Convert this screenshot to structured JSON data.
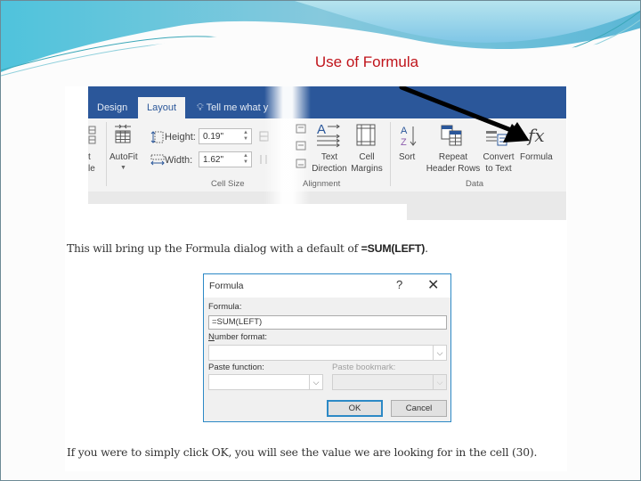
{
  "slide": {
    "title": "Use of Formula",
    "colors": {
      "title": "#c0141b",
      "ribbon_blue": "#2b579a",
      "dialog_border": "#2c89c6"
    }
  },
  "ribbon": {
    "tabs": [
      {
        "label": "Design",
        "active": false
      },
      {
        "label": "Layout",
        "active": true
      },
      {
        "label": "Tell me what y",
        "active": false,
        "icon": "lightbulb-icon"
      }
    ],
    "partial_left": {
      "line1": "t",
      "line2": "le"
    },
    "autofit": {
      "label": "AutoFit",
      "icon": "autofit-table-icon"
    },
    "cell_size": {
      "height_label": "Height:",
      "height_value": "0.19\"",
      "width_label": "Width:",
      "width_value": "1.62\"",
      "group_label": "Cell Size"
    },
    "alignment": {
      "text_direction": {
        "line1": "Text",
        "line2": "Direction"
      },
      "cell_margins": {
        "line1": "Cell",
        "line2": "Margins"
      },
      "group_label": "Alignment"
    },
    "data": {
      "sort": "Sort",
      "repeat_header_rows": {
        "line1": "Repeat",
        "line2": "Header Rows"
      },
      "convert_to_text": {
        "line1": "Convert",
        "line2": "to Text"
      },
      "formula": {
        "label": "Formula",
        "glyph": "fx"
      },
      "group_label": "Data"
    }
  },
  "text": {
    "intro_prefix": "This will bring up the Formula dialog with a default of ",
    "intro_bold": "=SUM(LEFT)",
    "intro_suffix": ".",
    "outro": "If you were to simply click OK, you will see the value we are looking for in the cell (30)."
  },
  "dialog": {
    "title": "Formula",
    "help": "?",
    "close": "✕",
    "formula_label": "Formula:",
    "formula_value": "=SUM(LEFT)",
    "number_format_label_u": "N",
    "number_format_label_rest": "umber format:",
    "number_format_value": "",
    "paste_function_label": "Paste function:",
    "paste_function_value": "",
    "paste_bookmark_label": "Paste bookmark:",
    "paste_bookmark_value": "",
    "ok": "OK",
    "cancel": "Cancel"
  }
}
